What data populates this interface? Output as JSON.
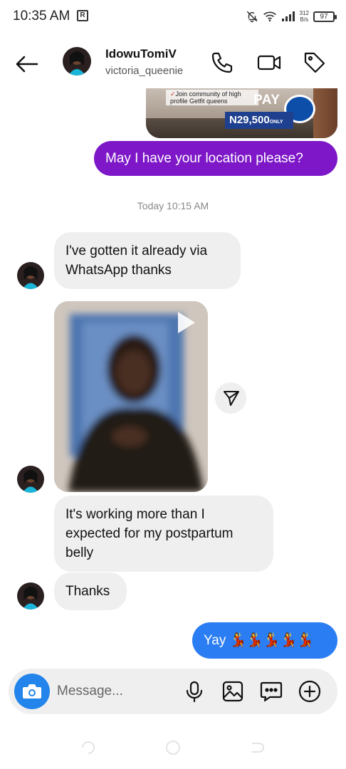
{
  "status_bar": {
    "time": "10:35 AM",
    "sim_badge": "R",
    "net_speed_value": "312",
    "net_speed_unit": "B/s",
    "battery": "97"
  },
  "header": {
    "name": "IdowuTomiV",
    "handle": "victoria_queenie"
  },
  "shared_card": {
    "banner_text": "Join community of high profile Getfit queens",
    "pay_label": "PAY",
    "price": "N29,500",
    "price_suffix": "ONLY"
  },
  "messages": {
    "m1_out": "May I have your location please?",
    "timestamp": "Today 10:15 AM",
    "m2_in": "I've gotten it already via WhatsApp thanks",
    "m3_in": "It's working more than I expected for my postpartum belly",
    "m4_in": "Thanks",
    "m5_out": "Yay 💃💃💃💃💃"
  },
  "composer": {
    "placeholder": "Message..."
  },
  "icons": {
    "back": "arrow-left-icon",
    "call": "phone-icon",
    "video": "video-camera-icon",
    "tag": "tag-icon",
    "share": "send-icon",
    "play": "play-icon",
    "camera": "camera-icon",
    "mic": "microphone-icon",
    "gallery": "image-icon",
    "sticker": "chat-bubble-icon",
    "add": "plus-circle-icon"
  },
  "colors": {
    "outgoing_purple": "#7d17c7",
    "outgoing_blue": "#2a7df2",
    "incoming_gray": "#efefef",
    "camera_blue": "#2384ec"
  }
}
